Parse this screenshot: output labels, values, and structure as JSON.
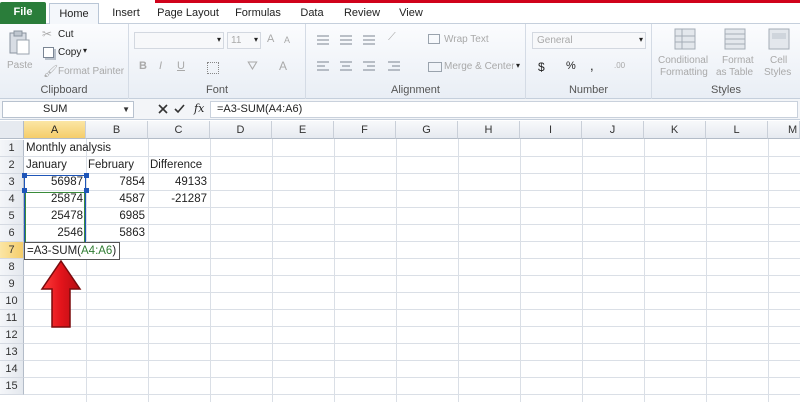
{
  "ribbon_tabs": {
    "file": "File",
    "home": "Home",
    "insert": "Insert",
    "page_layout": "Page Layout",
    "formulas": "Formulas",
    "data": "Data",
    "review": "Review",
    "view": "View"
  },
  "clipboard": {
    "paste": "Paste",
    "cut": "Cut",
    "copy": "Copy",
    "format_painter": "Format Painter",
    "group": "Clipboard"
  },
  "font": {
    "size": "11",
    "bold": "B",
    "italic": "I",
    "underline": "U",
    "grow": "A",
    "shrink": "A",
    "color_a": "A",
    "group": "Font"
  },
  "alignment": {
    "wrap_text": "Wrap Text",
    "merge_center": "Merge & Center",
    "group": "Alignment"
  },
  "number": {
    "format": "General",
    "currency": "$",
    "percent": "%",
    "comma": ",",
    "inc_decimal": ".00",
    "group": "Number"
  },
  "styles": {
    "conditional_1": "Conditional",
    "conditional_2": "Formatting",
    "format_table_1": "Format",
    "format_table_2": "as Table",
    "cell_styles_1": "Cell",
    "cell_styles_2": "Styles",
    "group": "Styles"
  },
  "formula_bar": {
    "name_box": "SUM",
    "fx": "fx",
    "formula": "=A3-SUM(A4:A6)"
  },
  "columns": [
    "A",
    "B",
    "C",
    "D",
    "E",
    "F",
    "G",
    "H",
    "I",
    "J",
    "K",
    "L",
    "M"
  ],
  "rows": [
    "1",
    "2",
    "3",
    "4",
    "5",
    "6",
    "7",
    "8",
    "9",
    "10",
    "11",
    "12",
    "13",
    "14",
    "15"
  ],
  "cells": {
    "a1": "Monthly analysis",
    "a2": "January",
    "b2": "February",
    "c2": "Difference",
    "a3": "56987",
    "b3": "7854",
    "c3": "49133",
    "a4": "25874",
    "b4": "4587",
    "c4": "-21287",
    "a5": "25478",
    "b5": "6985",
    "a6": "2546",
    "b6": "5863"
  },
  "editing_cell": {
    "prefix": "=A3-SUM(",
    "range": "A4:A6",
    "suffix": ")"
  },
  "colors": {
    "file_tab": "#2a7d3a",
    "selection_blue": "#1f56b8",
    "range_green": "#3a8b3a",
    "arrow_red": "#e3141b",
    "header_highlight": "#f5cd6a"
  },
  "annotation": {
    "icon": "red-up-arrow"
  }
}
